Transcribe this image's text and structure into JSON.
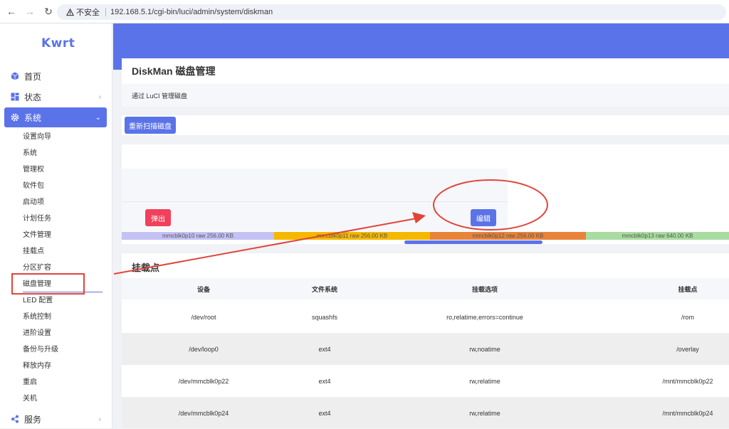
{
  "browser": {
    "security_label": "不安全",
    "url": "192.168.5.1/cgi-bin/luci/admin/system/diskman"
  },
  "sidebar": {
    "logo": "Kwrt",
    "top_items": [
      {
        "label": "首页",
        "icon": "cube-icon"
      },
      {
        "label": "状态",
        "icon": "dashboard-icon"
      },
      {
        "label": "系统",
        "icon": "gear-icon"
      },
      {
        "label": "服务",
        "icon": "share-icon"
      }
    ],
    "sub_items": [
      "设置向导",
      "系统",
      "管理权",
      "软件包",
      "启动项",
      "计划任务",
      "文件管理",
      "挂载点",
      "分区扩容",
      "磁盘管理",
      "LED 配置",
      "系统控制",
      "进阶设置",
      "备份与升级",
      "释放内存",
      "重启",
      "关机"
    ]
  },
  "main": {
    "title": "DiskMan 磁盘管理",
    "description": "通过 LuCI 管理磁盘",
    "rescan_button": "重新扫描磁盘",
    "eject_button": "弹出",
    "edit_button": "编辑",
    "partitions": [
      {
        "label": "mmcblk0p10 raw 256.00 KB",
        "color": "#c4c1f5"
      },
      {
        "label": "mmcblk0p11 raw 256.00 KB",
        "color": "#f5b800"
      },
      {
        "label": "mmcblk0p12 raw 256.00 KB",
        "color": "#e8833a"
      },
      {
        "label": "mmcblk0p13 raw 640.00 KB",
        "color": "#a9dca0"
      }
    ],
    "mounts": {
      "title": "挂载点",
      "columns": [
        "设备",
        "文件系统",
        "挂载选项",
        "挂载点"
      ],
      "rows": [
        [
          "/dev/root",
          "squashfs",
          "ro,relatime,errors=continue",
          "/rom"
        ],
        [
          "/dev/loop0",
          "ext4",
          "rw,noatime",
          "/overlay"
        ],
        [
          "/dev/mmcblk0p22",
          "ext4",
          "rw,relatime",
          "/mnt/mmcblk0p22"
        ],
        [
          "/dev/mmcblk0p24",
          "ext4",
          "rw,relatime",
          "/mnt/mmcblk0p24"
        ]
      ]
    }
  },
  "colors": {
    "accent": "#5b73e8",
    "danger": "#f0405a",
    "annotation": "#e0453a"
  }
}
